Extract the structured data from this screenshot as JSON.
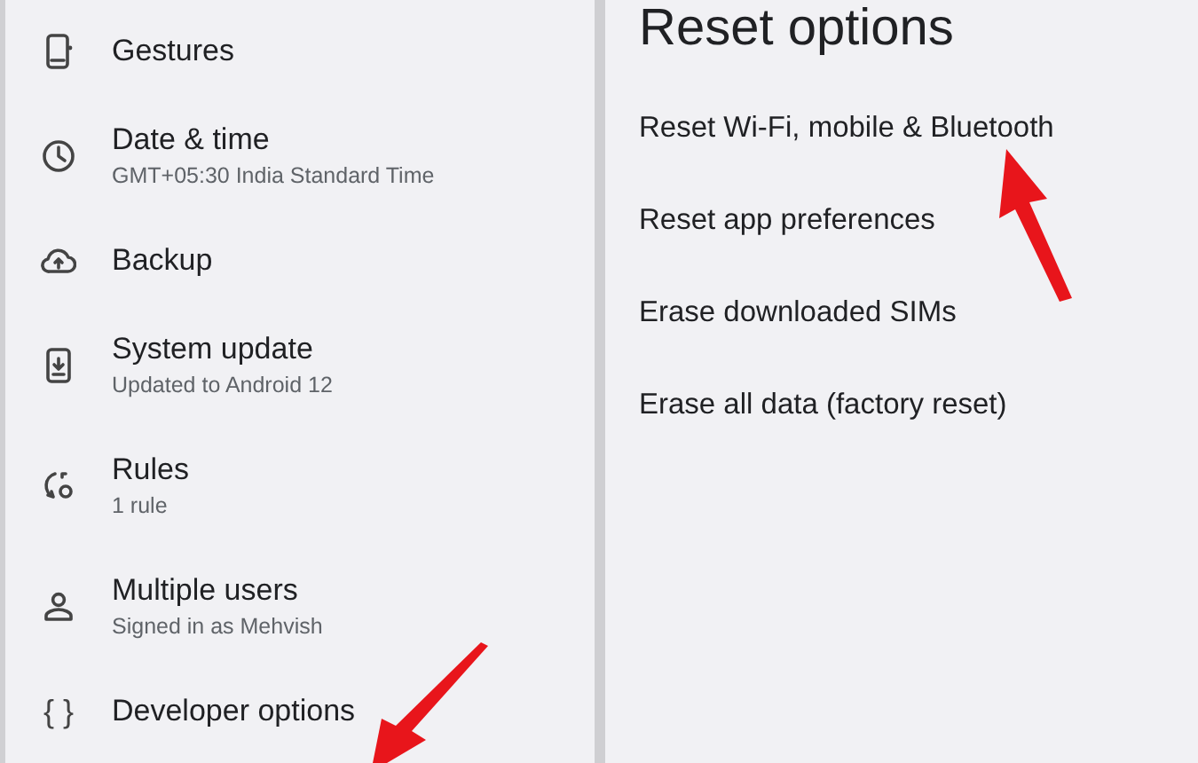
{
  "settings_list": [
    {
      "kind": "phone",
      "title": "Gestures"
    },
    {
      "kind": "clock",
      "title": "Date & time",
      "subtitle": "GMT+05:30 India Standard Time"
    },
    {
      "kind": "cloud",
      "title": "Backup"
    },
    {
      "kind": "update",
      "title": "System update",
      "subtitle": "Updated to Android 12"
    },
    {
      "kind": "rules",
      "title": "Rules",
      "subtitle": "1 rule"
    },
    {
      "kind": "person",
      "title": "Multiple users",
      "subtitle": "Signed in as Mehvish"
    },
    {
      "kind": "code",
      "glyph": "{ }",
      "title": "Developer options"
    }
  ],
  "reset_panel": {
    "title": "Reset options",
    "options": [
      "Reset Wi-Fi, mobile & Bluetooth",
      "Reset app preferences",
      "Erase downloaded SIMs",
      "Erase all data (factory reset)"
    ]
  }
}
